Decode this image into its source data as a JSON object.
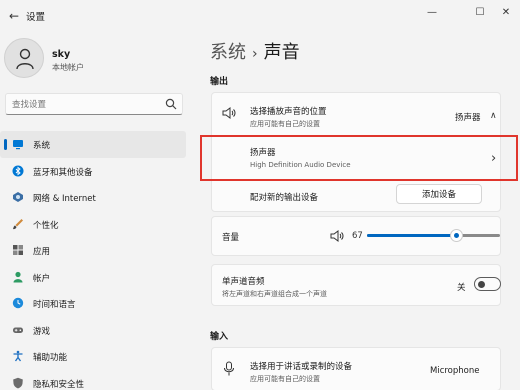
{
  "window": {
    "title": "设置",
    "back_glyph": "←",
    "minimize_glyph": "—",
    "maximize_glyph": "☐",
    "close_glyph": "✕"
  },
  "user": {
    "name": "sky",
    "account_type": "本地帐户"
  },
  "search": {
    "placeholder": "查找设置"
  },
  "sidebar": {
    "items": [
      {
        "label": "系统",
        "icon": "monitor-icon",
        "active": true
      },
      {
        "label": "蓝牙和其他设备",
        "icon": "bluetooth-icon"
      },
      {
        "label": "网络 & Internet",
        "icon": "network-icon"
      },
      {
        "label": "个性化",
        "icon": "brush-icon"
      },
      {
        "label": "应用",
        "icon": "apps-icon"
      },
      {
        "label": "帐户",
        "icon": "account-icon"
      },
      {
        "label": "时间和语言",
        "icon": "globe-clock-icon"
      },
      {
        "label": "游戏",
        "icon": "gamepad-icon"
      },
      {
        "label": "辅助功能",
        "icon": "accessibility-icon"
      },
      {
        "label": "隐私和安全性",
        "icon": "shield-icon"
      }
    ]
  },
  "breadcrumb": {
    "parent": "系统",
    "separator": "›",
    "current": "声音"
  },
  "output": {
    "section_label": "输出",
    "choose_device": {
      "title": "选择播放声音的位置",
      "subtitle": "应用可能有自己的设置",
      "value": "扬声器",
      "chevron": "∧"
    },
    "selected_device": {
      "name": "扬声器",
      "description": "High Definition Audio Device",
      "chevron": "›"
    },
    "pair_new": {
      "label": "配对新的输出设备",
      "button": "添加设备"
    },
    "volume": {
      "label": "音量",
      "value": 67,
      "value_text": "67"
    },
    "mono_audio": {
      "title": "单声道音频",
      "subtitle": "将左声道和右声道组合成一个声道",
      "state_text": "关",
      "on": false
    }
  },
  "input": {
    "section_label": "输入",
    "choose_device": {
      "title": "选择用于讲话或录制的设备",
      "subtitle": "应用可能有自己的设置",
      "value": "Microphone"
    }
  },
  "colors": {
    "accent": "#0067c0",
    "highlight_border": "#e0352c",
    "background": "#f3f3f3",
    "card": "#fbfbfb"
  }
}
